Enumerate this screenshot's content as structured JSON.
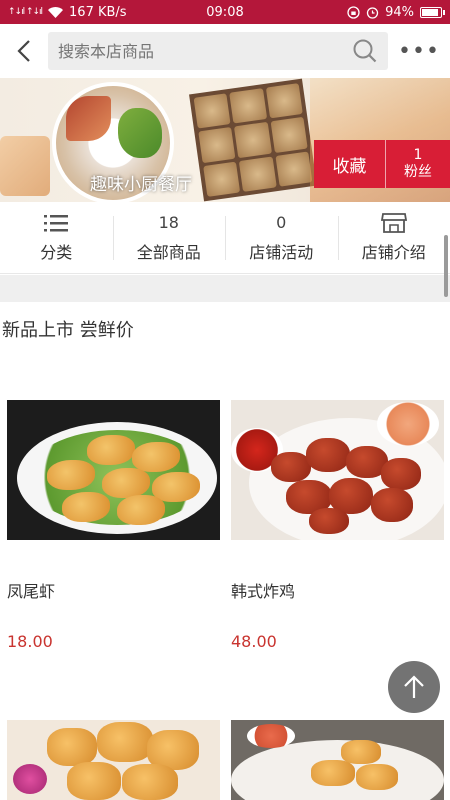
{
  "status_bar": {
    "signal_text": "↑↓ıl ↑↓ıl",
    "speed": "167 KB/s",
    "time": "09:08",
    "battery_pct": "94%",
    "battery_level": 0.94,
    "color": "#b4173a"
  },
  "header": {
    "search_placeholder": "搜索本店商品",
    "more_label": "•••"
  },
  "banner": {
    "shop_name": "趣味小厨餐厅",
    "favorite_label": "收藏",
    "fans_count": "1",
    "fans_label": "粉丝",
    "accent": "#d81e36"
  },
  "nav": {
    "items": [
      {
        "top": "",
        "label": "分类",
        "icon": "list-icon"
      },
      {
        "top": "18",
        "label": "全部商品"
      },
      {
        "top": "0",
        "label": "店铺活动"
      },
      {
        "top": "",
        "label": "店铺介绍",
        "icon": "store-icon"
      }
    ]
  },
  "section": {
    "title": "新品上市 尝鲜价"
  },
  "products": [
    {
      "name": "凤尾虾",
      "price": "18.00",
      "image": "fried-shrimp-image"
    },
    {
      "name": "韩式炸鸡",
      "price": "48.00",
      "image": "korean-fried-chicken-image"
    },
    {
      "name": "",
      "price": "",
      "image": "chicken-nuggets-image"
    },
    {
      "name": "",
      "price": "",
      "image": "fried-snack-image"
    }
  ],
  "colors": {
    "price": "#c9342f",
    "brand": "#b4173a"
  }
}
